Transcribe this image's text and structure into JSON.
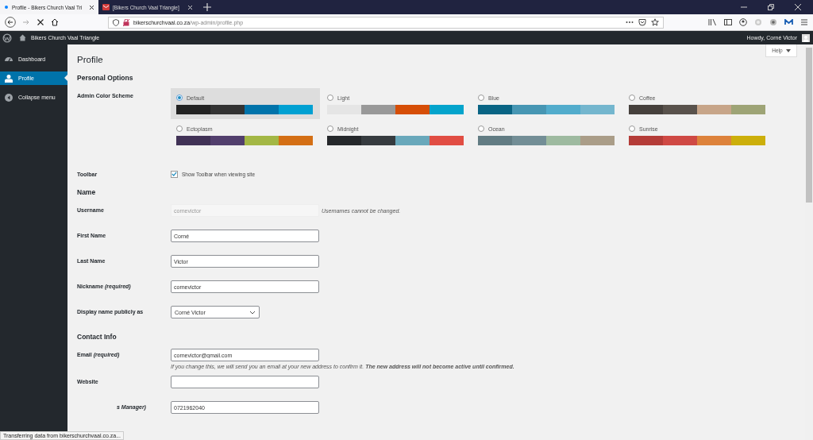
{
  "browser": {
    "tabs": [
      {
        "title": "Profile - Bikers Church Vaal Tri",
        "selected": true,
        "kind": "loading"
      },
      {
        "title": "[Bikers Church Vaal Triangle]",
        "selected": false,
        "kind": "mail"
      }
    ],
    "url_host": "bikerschurchvaal.co.za",
    "url_path": "/wp-admin/profile.php"
  },
  "admin_bar": {
    "site_name": "Bikers Church Vaal Triangle",
    "greeting": "Howdy, Corné Victor"
  },
  "sidebar": {
    "items": [
      {
        "label": "Dashboard",
        "selected": false,
        "kind": "dashboard"
      },
      {
        "label": "Profile",
        "selected": true,
        "kind": "profile"
      },
      {
        "label": "Collapse menu",
        "selected": false,
        "kind": "collapse"
      }
    ]
  },
  "page": {
    "title": "Profile",
    "help_button": "Help"
  },
  "sections": [
    {
      "heading": "Personal Options",
      "rows": [
        {
          "kind": "color_scheme",
          "label": "Admin Color Scheme",
          "schemes": [
            {
              "name": "Default",
              "selected": true,
              "swatches": [
                {
                  "color": "#222222"
                },
                {
                  "color": "#333333"
                },
                {
                  "color": "#0073aa"
                },
                {
                  "color": "#00a0d2"
                }
              ]
            },
            {
              "name": "Light",
              "selected": false,
              "swatches": [
                {
                  "color": "#e5e5e5"
                },
                {
                  "color": "#999999"
                },
                {
                  "color": "#d64e07"
                },
                {
                  "color": "#04a4cc"
                }
              ]
            },
            {
              "name": "Blue",
              "selected": false,
              "swatches": [
                {
                  "color": "#096484"
                },
                {
                  "color": "#4796b3"
                },
                {
                  "color": "#52accc"
                },
                {
                  "color": "#74b6ce"
                }
              ]
            },
            {
              "name": "Coffee",
              "selected": false,
              "swatches": [
                {
                  "color": "#46403c"
                },
                {
                  "color": "#59524c"
                },
                {
                  "color": "#c7a589"
                },
                {
                  "color": "#9ea476"
                }
              ]
            },
            {
              "name": "Ectoplasm",
              "selected": false,
              "swatches": [
                {
                  "color": "#413256"
                },
                {
                  "color": "#523f6d"
                },
                {
                  "color": "#a3b745"
                },
                {
                  "color": "#d46f15"
                }
              ]
            },
            {
              "name": "Midnight",
              "selected": false,
              "swatches": [
                {
                  "color": "#25282b"
                },
                {
                  "color": "#363b3f"
                },
                {
                  "color": "#69a8bb"
                },
                {
                  "color": "#e14d43"
                }
              ]
            },
            {
              "name": "Ocean",
              "selected": false,
              "swatches": [
                {
                  "color": "#627c83"
                },
                {
                  "color": "#738e96"
                },
                {
                  "color": "#9ebaa0"
                },
                {
                  "color": "#aa9d88"
                }
              ]
            },
            {
              "name": "Sunrise",
              "selected": false,
              "swatches": [
                {
                  "color": "#b43c38"
                },
                {
                  "color": "#cf4944"
                },
                {
                  "color": "#dd823b"
                },
                {
                  "color": "#ccaf0b"
                }
              ]
            }
          ]
        },
        {
          "kind": "checkbox",
          "label": "Toolbar",
          "text": "Show Toolbar when viewing site",
          "checked": true
        }
      ]
    },
    {
      "heading": "Name",
      "rows": [
        {
          "kind": "text",
          "label": "Username",
          "value": "cornevictor",
          "disabled": true,
          "note": "Usernames cannot be changed."
        },
        {
          "kind": "text",
          "label": "First Name",
          "value": "Corné",
          "disabled": false
        },
        {
          "kind": "text",
          "label": "Last Name",
          "value": "Victor",
          "disabled": false
        },
        {
          "kind": "text",
          "label": "Nickname *(required)*",
          "value": "cornevictor",
          "disabled": false
        },
        {
          "kind": "select",
          "label": "Display name publicly as",
          "value": "Corné Victor"
        }
      ]
    },
    {
      "heading": "Contact Info",
      "rows": [
        {
          "kind": "text",
          "label": "Email *(required)*",
          "value": "cornevictor@gmail.com",
          "disabled": false,
          "description": "If you change this, we will send you an email at your new address to confirm it. **The new address will not become active until confirmed.**"
        },
        {
          "kind": "text",
          "label": "Website",
          "disabled": false
        },
        {
          "kind": "text",
          "label": "*s Manager)*",
          "value": "0721962040",
          "disabled": false,
          "partial": true
        }
      ]
    }
  ],
  "status_bar": "Transferring data from bikerschurchvaal.co.za..."
}
